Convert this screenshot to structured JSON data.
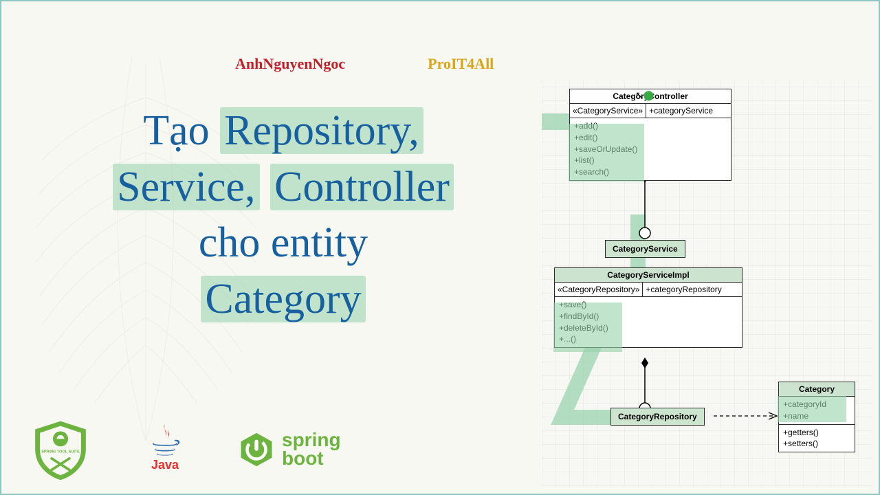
{
  "header": {
    "author": "AnhNguyenNgoc",
    "brand": "ProIT4All"
  },
  "title": {
    "w0": "Tạo",
    "w1": "Repository,",
    "w2": "Service,",
    "w3": "Controller",
    "w4": "cho entity",
    "w5": "Category"
  },
  "logos": {
    "sts": "SPRING TOOL SUITE",
    "java": "Java",
    "spring1": "spring",
    "spring2": "boot"
  },
  "uml": {
    "controller": {
      "name": "CategoryController",
      "stereo": "«CategoryService»",
      "field": "+categoryService",
      "ops": [
        "+add()",
        "+edit()",
        "+saveOrUpdate()",
        "+list()",
        "+search()"
      ]
    },
    "service_label": "CategoryService",
    "impl": {
      "name": "CategoryServiceImpl",
      "stereo": "«CategoryRepository»",
      "field": "+categoryRepository",
      "ops": [
        "+save()",
        "+findById()",
        "+deleteById()",
        "+...()"
      ]
    },
    "repo_label": "CategoryRepository",
    "entity": {
      "name": "Category",
      "fields": [
        "+categoryId",
        "+name"
      ],
      "ops": [
        "+getters()",
        "+setters()"
      ]
    }
  }
}
